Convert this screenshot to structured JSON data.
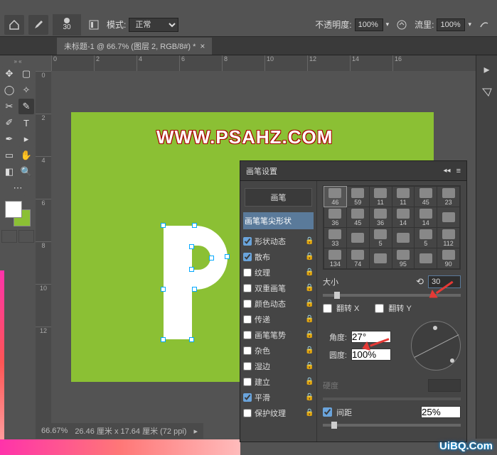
{
  "options_bar": {
    "brush_size_below_icon": "30",
    "mode_label": "模式:",
    "mode_value": "正常",
    "opacity_label": "不透明度:",
    "opacity_value": "100%",
    "flow_label": "流里:",
    "flow_value": "100%"
  },
  "document": {
    "tab_title": "未标题-1 @ 66.7% (图层 2, RGB/8#) *"
  },
  "ruler_h": [
    "0",
    "2",
    "4",
    "6",
    "8",
    "10",
    "12",
    "14",
    "16"
  ],
  "ruler_v": [
    "0",
    "2",
    "4",
    "6",
    "8",
    "10",
    "12"
  ],
  "canvas": {
    "watermark_url": "WWW.PSAHZ.COM",
    "bg_color": "#8bc034",
    "letter_color": "#ffffff"
  },
  "status": {
    "zoom": "66.67%",
    "dims": "26.46 厘米 x 17.64 厘米 (72 ppi)"
  },
  "panel": {
    "title": "画笔设置",
    "left": {
      "brushes_btn": "画笔",
      "tip_shape": "画笔笔尖形状",
      "items": [
        {
          "label": "形状动态",
          "checked": true
        },
        {
          "label": "散布",
          "checked": true
        },
        {
          "label": "纹理",
          "checked": false
        },
        {
          "label": "双重画笔",
          "checked": false
        },
        {
          "label": "颜色动态",
          "checked": false
        },
        {
          "label": "传递",
          "checked": false
        },
        {
          "label": "画笔笔势",
          "checked": false
        },
        {
          "label": "杂色",
          "checked": false
        },
        {
          "label": "湿边",
          "checked": false
        },
        {
          "label": "建立",
          "checked": false
        },
        {
          "label": "平滑",
          "checked": true
        },
        {
          "label": "保护纹理",
          "checked": false
        }
      ]
    },
    "right": {
      "brush_sizes_row1": [
        "46",
        "59",
        "11",
        "11",
        "45",
        "23"
      ],
      "brush_sizes_row2": [
        "36",
        "45",
        "36",
        "14",
        "14",
        ""
      ],
      "brush_sizes_row3": [
        "33",
        "",
        "5",
        "",
        "5",
        "112"
      ],
      "brush_sizes_row4": [
        "134",
        "74",
        "",
        "95",
        "",
        "90"
      ],
      "size_label": "大小",
      "size_value": "30",
      "flip_x_label": "翻转 X",
      "flip_y_label": "翻转 Y",
      "angle_label": "角度:",
      "angle_value": "27°",
      "roundness_label": "圆度:",
      "roundness_value": "100%",
      "hardness_label": "硬度",
      "spacing_label": "间距",
      "spacing_value": "25%"
    }
  },
  "watermark_site": "UiBQ.Com"
}
